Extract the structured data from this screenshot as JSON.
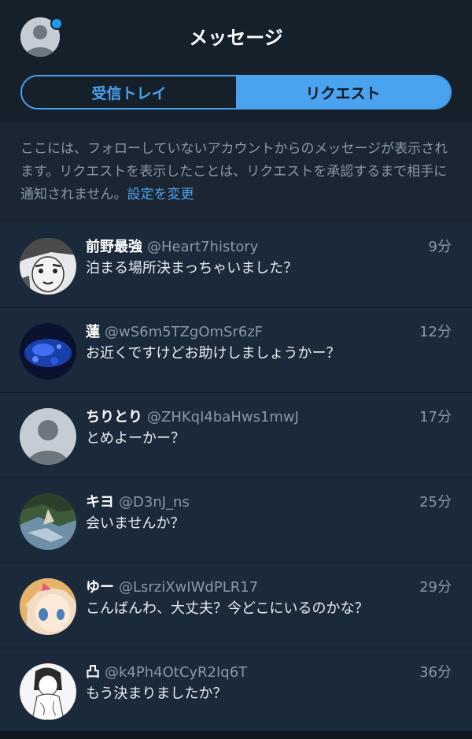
{
  "header": {
    "title": "メッセージ",
    "avatar_icon": "default-user-avatar",
    "notification_dot": true
  },
  "tabs": {
    "inbox_label": "受信トレイ",
    "request_label": "リクエスト",
    "active": "リクエスト"
  },
  "notice": {
    "text": "ここには、フォローしていないアカウントからのメッセージが表示されます。リクエストを表示したことは、リクエストを承認するまで相手に通知されません。",
    "link": "設定を変更"
  },
  "requests": [
    {
      "name": "前野最強",
      "handle": "@Heart7history",
      "time": "9分",
      "message": "泊まる場所決まっちゃいました？",
      "avatar": "manga-face-avatar"
    },
    {
      "name": "蓮",
      "handle": "@wS6m5TZgOmSr6zF",
      "time": "12分",
      "message": "お近くですけどお助けしましょうかー？",
      "avatar": "blue-light-avatar"
    },
    {
      "name": "ちりとり",
      "handle": "@ZHKqI4baHws1mwJ",
      "time": "17分",
      "message": "とめよーかー？",
      "avatar": "default-user-avatar"
    },
    {
      "name": "キヨ",
      "handle": "@D3nJ_ns",
      "time": "25分",
      "message": "会いませんか？",
      "avatar": "landscape-avatar"
    },
    {
      "name": "ゆー",
      "handle": "@LsrziXwIWdPLR17",
      "time": "29分",
      "message": "こんばんわ、大丈夫？今どこにいるのかな？",
      "avatar": "anime-girl-avatar"
    },
    {
      "name": "凸",
      "handle": "@k4Ph4OtCyR2Iq6T",
      "time": "36分",
      "message": "もう決まりましたか？",
      "avatar": "manga-girl-avatar"
    }
  ],
  "colors": {
    "background": "#15202b",
    "accent": "#4aa3ef",
    "row": "#1b2a3a",
    "muted": "#8899a6"
  }
}
